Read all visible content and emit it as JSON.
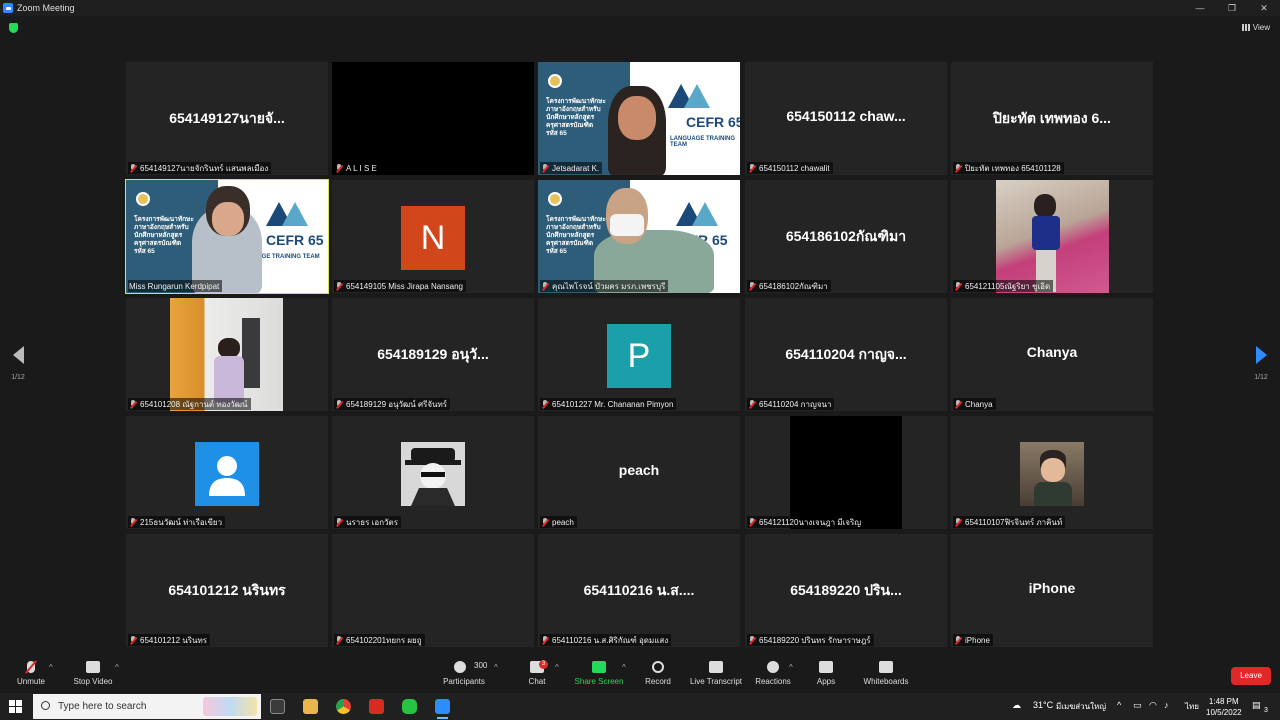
{
  "window": {
    "title": "Zoom Meeting"
  },
  "view_label": "View",
  "page_indicator_left": "1/12",
  "page_indicator_right": "1/12",
  "tiles": [
    {
      "big": "654149127นายจั...",
      "label": "654149127นายจักรินทร์ แสนพลเมือง"
    },
    {
      "big": "",
      "label": "A L I S E"
    },
    {
      "big": "",
      "label": "Jetsadarat K."
    },
    {
      "big": "654150112 chaw...",
      "label": "654150112 chawalit"
    },
    {
      "big": "ปิยะทัต เทพทอง 6...",
      "label": "ปิยะทัต เทพทอง 654101128"
    },
    {
      "big": "",
      "label": "Miss Rungarun Kerdpipat"
    },
    {
      "big": "N",
      "label": "654149105 Miss Jirapa Nansang"
    },
    {
      "big": "",
      "label": "คุณไพโรจน์ บัวผคร มรภ.เพชรบุรี"
    },
    {
      "big": "654186102กัณฑิมา",
      "label": "654186102กัณฑิมา"
    },
    {
      "big": "",
      "label": "654121105ณัฐริยา ชูเอิด"
    },
    {
      "big": "",
      "label": "654101208 ณัฐกานต์ ทองวัฒน์"
    },
    {
      "big": "654189129 อนุวั...",
      "label": "654189129 อนุวัฒน์ ศรีจันทร์"
    },
    {
      "big": "P",
      "label": "654101227 Mr. Chananan Pimyon"
    },
    {
      "big": "654110204 กาญจ...",
      "label": "654110204 กาญจนา"
    },
    {
      "big": "Chanya",
      "label": "Chanya"
    },
    {
      "big": "",
      "label": "215ธนวัฒน์ ท่าเรือเขียว"
    },
    {
      "big": "",
      "label": "นราธร เอกวัตร"
    },
    {
      "big": "peach",
      "label": "peach"
    },
    {
      "big": "",
      "label": "654121120นางเจนฎา มีเจริญ"
    },
    {
      "big": "",
      "label": "654110107ฟิรจินทร์ ภาคินท์"
    },
    {
      "big": "654101212 นรินทร",
      "label": "654101212 นรินทร"
    },
    {
      "big": "",
      "label": "654102201ทยกร ผยฤู"
    },
    {
      "big": "654110216 น.ส....",
      "label": "654110216 น.ส.ศิริกัณฑ์ อุดมแสง"
    },
    {
      "big": "654189220 ปริน...",
      "label": "654189220 ปรินทร รักษาราษฎร์"
    },
    {
      "big": "iPhone",
      "label": "iPhone"
    }
  ],
  "presentation": {
    "line1": "โครงการพัฒนาทักษะ",
    "line2": "ภาษาอังกฤษสำหรับ",
    "line3": "นักศึกษาหลักสูตร",
    "line4": "ครุศาสตรบัณฑิต",
    "line5": "รหัส 65",
    "cefr": "CEFR 65",
    "team": "LANGUAGE TRAINING TEAM"
  },
  "toolbar": {
    "unmute": "Unmute",
    "stop_video": "Stop Video",
    "participants": "Participants",
    "participants_count": "300",
    "chat": "Chat",
    "chat_badge": "3",
    "share_screen": "Share Screen",
    "record": "Record",
    "live_transcript": "Live Transcript",
    "reactions": "Reactions",
    "apps": "Apps",
    "whiteboards": "Whiteboards",
    "leave": "Leave"
  },
  "taskbar": {
    "search_placeholder": "Type here to search",
    "weather": "31°C",
    "weather_desc": "มีเมฆส่วนใหญ่",
    "lang": "ไทย",
    "time": "1:48 PM",
    "date": "10/5/2022",
    "notif_count": "3"
  },
  "colors": {
    "accent_blue": "#2d8cff",
    "active_speaker": "#d8e63c",
    "leave_red": "#e02828",
    "share_green": "#23d959",
    "avatar_n": "#d1461b",
    "avatar_p": "#1aa0a8",
    "avatar_user": "#1e90e6"
  }
}
